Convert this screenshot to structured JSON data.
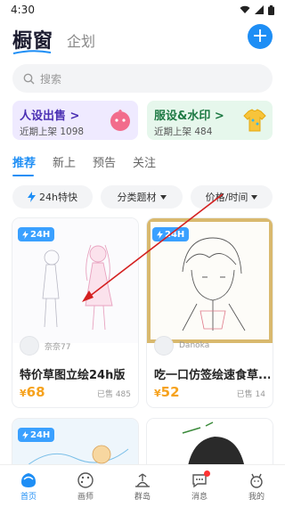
{
  "status_bar": {
    "time": "4:30"
  },
  "header": {
    "logo": "橱窗",
    "plan_tab": "企划",
    "add_symbol": "+"
  },
  "search": {
    "placeholder": "搜索"
  },
  "banners": [
    {
      "title": "人设出售 >",
      "subtitle": "近期上架 1098"
    },
    {
      "title": "服设&水印 >",
      "subtitle": "近期上架 484"
    }
  ],
  "tabs": [
    "推荐",
    "新上",
    "预告",
    "关注"
  ],
  "filters": {
    "fast": "24h特快",
    "category": "分类题材",
    "sort": "价格/时间"
  },
  "cards": [
    {
      "badge": "24H",
      "author": "奈奈77",
      "title": "特价草图立绘24h版",
      "currency": "¥",
      "price": "68",
      "sold": "已售 485"
    },
    {
      "badge": "24H",
      "author": "Danoka",
      "title": "吃一口仿签绘速食草...",
      "currency": "¥",
      "price": "52",
      "sold": "已售 14"
    },
    {
      "badge": "24H"
    },
    {}
  ],
  "bottom_nav": [
    {
      "label": "首页",
      "icon": "home-icon"
    },
    {
      "label": "画师",
      "icon": "palette-icon"
    },
    {
      "label": "群岛",
      "icon": "island-icon"
    },
    {
      "label": "消息",
      "icon": "message-icon"
    },
    {
      "label": "我的",
      "icon": "profile-icon"
    }
  ],
  "colors": {
    "accent": "#1e8ef5",
    "price": "#f6a21d",
    "badge": "#3aa0ff",
    "arrow": "#d42020"
  }
}
